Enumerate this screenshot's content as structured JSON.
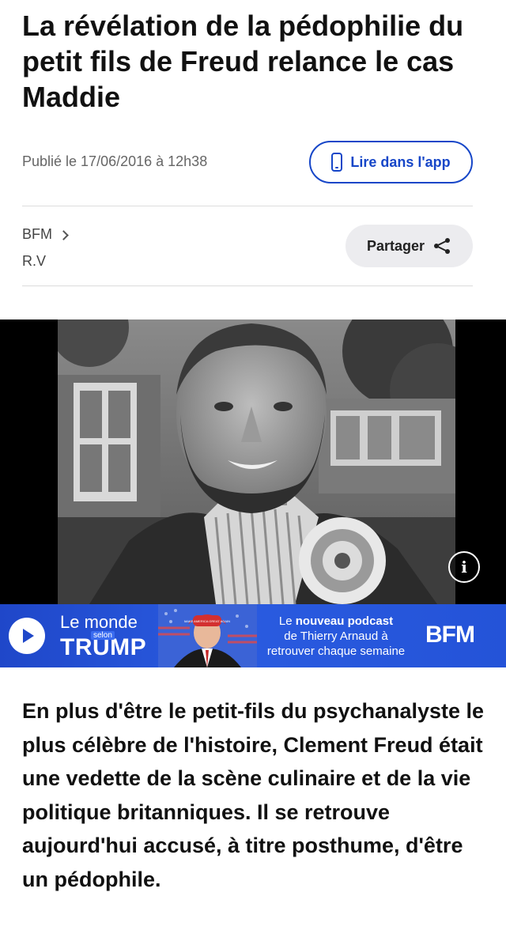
{
  "article": {
    "title": "La révélation de la pédophilie du petit fils de Freud relance le cas Maddie",
    "published": "Publié le 17/06/2016 à 12h38",
    "source": "BFM",
    "author": "R.V",
    "lead": "En plus d'être le petit-fils du psychanalyste le plus célèbre de l'histoire, Clement Freud était une vedette de la scène culinaire et de la vie politique britanniques. Il se retrouve aujourd'hui accusé, à titre posthume, d'être un pédophile."
  },
  "actions": {
    "read_in_app": "Lire dans l'app",
    "share": "Partager",
    "info": "i"
  },
  "banner": {
    "show_line1": "Le monde",
    "show_small": "selon",
    "show_line2": "TRUMP",
    "text_prefix": "Le",
    "text_bold": "nouveau podcast",
    "text_line2": "de Thierry Arnaud à",
    "text_line3": "retrouver chaque semaine",
    "logo": "BFM",
    "cap_text": "MAKE AMERICA GREAT AGAIN"
  },
  "colors": {
    "accent": "#1646c8",
    "banner_blue": "#2453d8",
    "share_bg": "#ececef"
  },
  "icons": {
    "read_in_app": "phone-icon",
    "share": "share-icon",
    "source_link": "chevron-right-icon",
    "banner_play": "play-icon",
    "photo_info": "info-icon"
  }
}
